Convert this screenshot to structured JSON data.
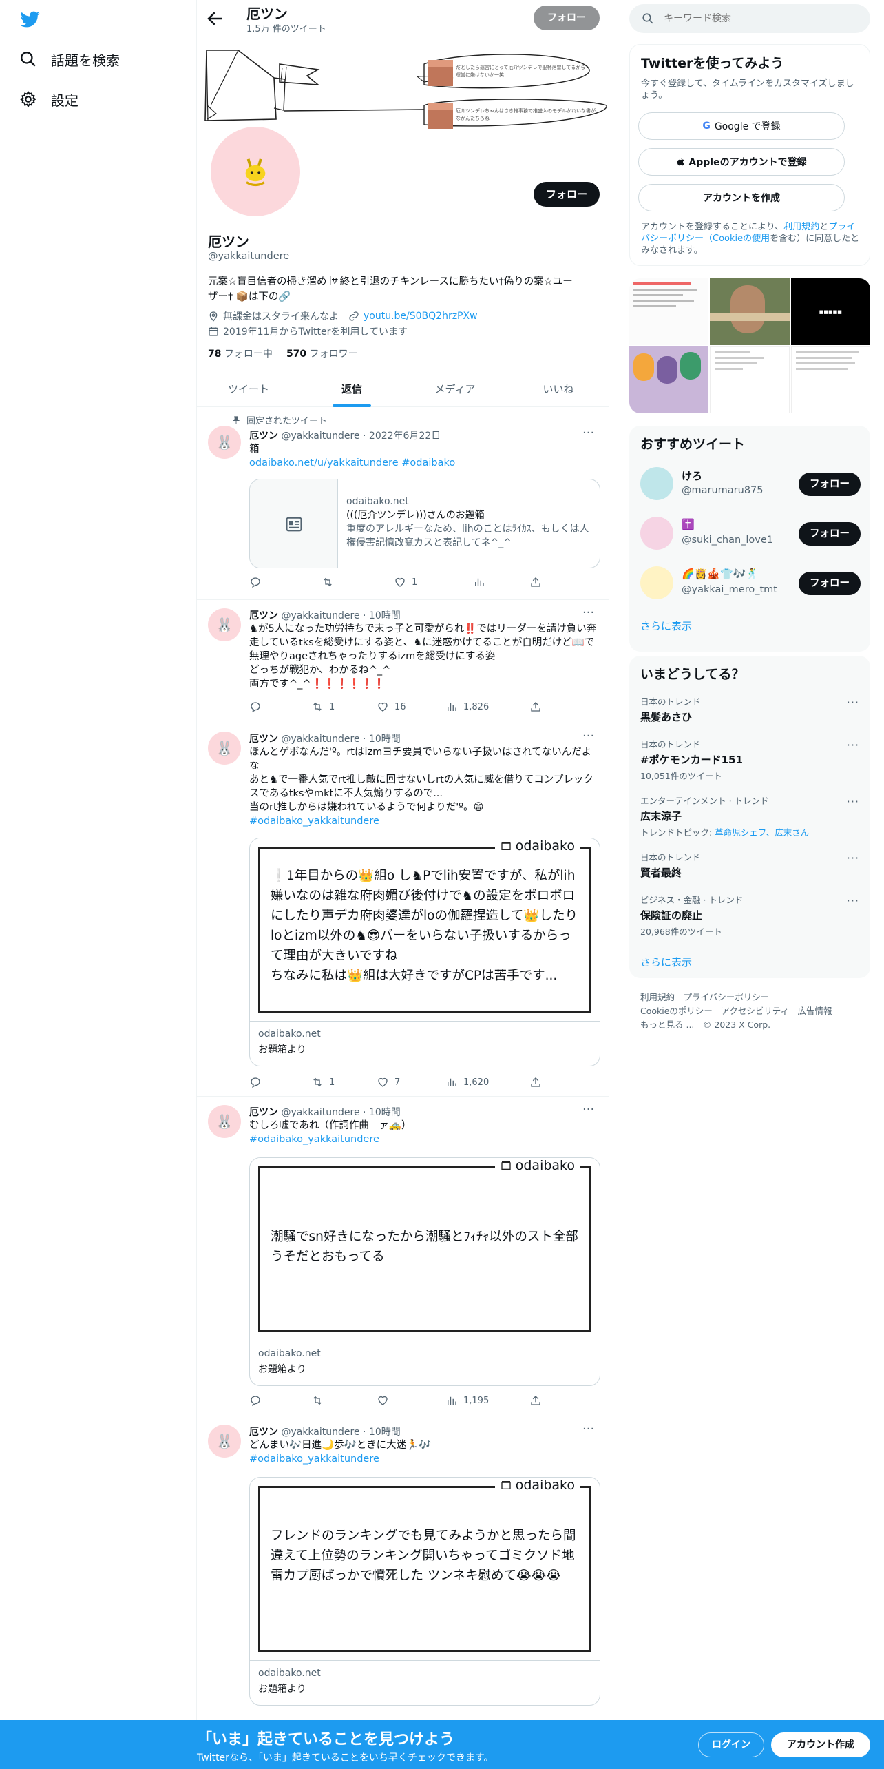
{
  "nav": {
    "search_label": "話題を検索",
    "settings_label": "設定"
  },
  "profile_header": {
    "name": "厄ツン",
    "tweet_count": "1.5万 件のツイート",
    "follow_label": "フォロー"
  },
  "profile": {
    "name": "厄ツン",
    "handle": "@yakkaitundere",
    "follow_label": "フォロー",
    "bio_line1": "元案☆盲目信者の掃き溜め 🈂終と引退のチキンレースに勝ちたい†偽りの案☆ユー",
    "bio_line2": "ザー† 📦は下の🔗",
    "location": "無課金はスタライ来んなよ",
    "url": "youtu.be/S0BQ2hrzPXw",
    "joined": "2019年11月からTwitterを利用しています",
    "following_count": "78",
    "following_label": "フォロー中",
    "followers_count": "570",
    "followers_label": "フォロワー",
    "banner_note1": "だとしたら運営にとって厄介ツンデレで聖杯落雷してるから運営に嫌はないか一笑",
    "banner_note2": "厄介ツンデレちゃんはさき推事務で推盛入のモデルかれいな書がなかんたちろね"
  },
  "tabs": [
    "ツイート",
    "返信",
    "メディア",
    "いいね"
  ],
  "active_tab": "返信",
  "tweets": [
    {
      "pinned_label": "固定されたツイート",
      "name": "厄ツン",
      "handle": "@yakkaitundere",
      "time": "2022年6月22日",
      "text": "箱",
      "links": "odaibako.net/u/yakkaitundere #odaibako",
      "card_domain": "odaibako.net",
      "card_title": "(((厄介ツンデレ)))さんのお題箱",
      "card_desc": "重度のアレルギーなため、lihのことはﾗｲｶｽ、もしくは人権侵害記憶改竄カスと表記してネ^_^",
      "reply": "",
      "retweet": "",
      "like": "1",
      "views": ""
    },
    {
      "name": "厄ツン",
      "handle": "@yakkaitundere",
      "time": "10時間",
      "text": "♞が5人になった功労持ちで末っ子と可愛がられ‼️ではリーダーを請け負い奔走しているtksを総受けにする姿と、♞に迷惑かけてることが自明だけど📖で無理やりageされちゃったりするizmを総受けにする姿\nどっちが戦犯か、わかるね^_^\n両方です^_^❗❗❗❗❗❗",
      "reply": "",
      "retweet": "1",
      "like": "16",
      "views": "1,826"
    },
    {
      "name": "厄ツン",
      "handle": "@yakkaitundere",
      "time": "10時間",
      "text": "ほんとゲボなんだ'º。rtはizmヨチ要員でいらない子扱いはされてないんだよな\nあと♞で一番人気でrt推し敵に回せないしrtの人気に威を借りてコンプレックスであるtksやmktに不人気煽りするので...\n当のrt推しからは嫌われているようで何よりだ'º。😁",
      "hashtag": "#odaibako_yakkaitundere",
      "card_text": "❕1年目からの👑組o し♞Pでlih安置ですが、私がlih嫌いなのは雑な府肉媚び後付けで♞の設定をボロボロにしたり声デカ府肉婆達がloの伽羅捏造して👑したりloとizm以外の♞😎バーをいらない子扱いするからって理由が大きいですね\nちなみに私は👑組は大好きですがCPは苦手です...",
      "card_domain": "odaibako.net",
      "card_title": "お題箱より",
      "reply": "",
      "retweet": "1",
      "like": "7",
      "views": "1,620"
    },
    {
      "name": "厄ツン",
      "handle": "@yakkaitundere",
      "time": "10時間",
      "text": "むしろ嘘であれ（作詞作曲　ァ🚕）",
      "hashtag": "#odaibako_yakkaitundere",
      "card_text": "潮騒でsn好きになったから潮騒とﾌｨﾁｬ以外のスト全部うそだとおもってる",
      "card_domain": "odaibako.net",
      "card_title": "お題箱より",
      "reply": "",
      "retweet": "",
      "like": "",
      "views": "1,195"
    },
    {
      "name": "厄ツン",
      "handle": "@yakkaitundere",
      "time": "10時間",
      "text": "どんまい🎶日進🌙歩🎶ときに大迷🏃🎶",
      "hashtag": "#odaibako_yakkaitundere",
      "card_text": "フレンドのランキングでも見てみようかと思ったら間違えて上位勢のランキング開いちゃってゴミクソド地雷カプ厨ばっかで憤死した ツンネキ慰めて😭😭😭",
      "card_domain": "odaibako.net",
      "card_title": "お題箱より"
    }
  ],
  "card_logo": "odaibako",
  "right": {
    "search_placeholder": "キーワード検索",
    "signup_title": "Twitterを使ってみよう",
    "signup_desc": "今すぐ登録して、タイムラインをカスタマイズしましょう。",
    "google_btn": "Google で登録",
    "apple_btn": "Appleのアカウントで登録",
    "create_btn": "アカウントを作成",
    "terms_pre": "アカウントを登録することにより、",
    "terms_link1": "利用規約",
    "terms_mid": "と",
    "terms_link2": "プライバシーポリシー（Cookieの使用",
    "terms_post": "を含む）に同意したとみなされます。",
    "rec_title": "おすすめツイート",
    "recs": [
      {
        "name": "けろ",
        "handle": "@marumaru875",
        "btn": "フォロー"
      },
      {
        "name": "✝️",
        "handle": "@suki_chan_love1",
        "btn": "フォロー"
      },
      {
        "name": "🌈👸🎪👕🎶🕺",
        "handle": "@yakkai_mero_tmt",
        "btn": "フォロー"
      }
    ],
    "show_more": "さらに表示",
    "trends_title": "いまどうしてる？",
    "trends": [
      {
        "cat": "日本のトレンド",
        "name": "黒髪あさひ",
        "cnt": ""
      },
      {
        "cat": "日本のトレンド",
        "name": "#ポケモンカード151",
        "cnt": "10,051件のツイート"
      },
      {
        "cat": "エンターテインメント · トレンド",
        "name": "広末涼子",
        "cnt": "トレンドトピック: ",
        "cnt_links": "革命児シェフ、広末さん"
      },
      {
        "cat": "日本のトレンド",
        "name": "賢者最終",
        "cnt": ""
      },
      {
        "cat": "ビジネス・金融 · トレンド",
        "name": "保険証の廃止",
        "cnt": "20,968件のツイート"
      }
    ],
    "trends_more": "さらに表示",
    "footer_line1": "利用規約　プライバシーポリシー",
    "footer_line2": "Cookieのポリシー　アクセシビリティ　広告情報",
    "footer_line3": "もっと見る ...　© 2023 X Corp."
  },
  "banner": {
    "title": "「いま」起きていることを見つけよう",
    "subtitle": "Twitterなら、「いま」起きていることをいち早くチェックできます。",
    "login": "ログイン",
    "signup": "アカウント作成"
  },
  "colors": {
    "brand": "#1d9bf0",
    "avatar_bg": "#fcd8dc"
  }
}
